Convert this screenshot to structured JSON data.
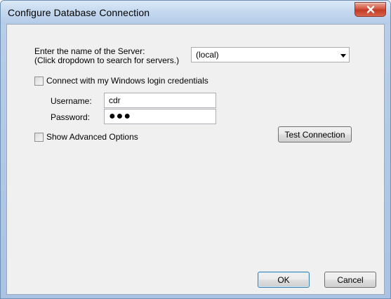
{
  "window": {
    "title": "Configure Database Connection",
    "close_glyph": "✕"
  },
  "server": {
    "label_line1": "Enter the name of the Server:",
    "label_line2": "(Click dropdown to search for servers.)",
    "selected_value": "(local)"
  },
  "windows_login": {
    "label": "Connect with my Windows login credentials",
    "checked": false
  },
  "username": {
    "label": "Username:",
    "value": "cdr"
  },
  "password": {
    "label": "Password:",
    "masked_value": "●●●"
  },
  "advanced": {
    "label": "Show Advanced Options",
    "checked": false
  },
  "buttons": {
    "test_connection": "Test Connection",
    "ok": "OK",
    "cancel": "Cancel"
  },
  "icons": {
    "close": "close-icon",
    "dropdown": "chevron-down-icon"
  },
  "colors": {
    "close_button": "#c23c24",
    "dialog_background": "#f0f0f0",
    "default_button_border": "#3c7fb1"
  }
}
